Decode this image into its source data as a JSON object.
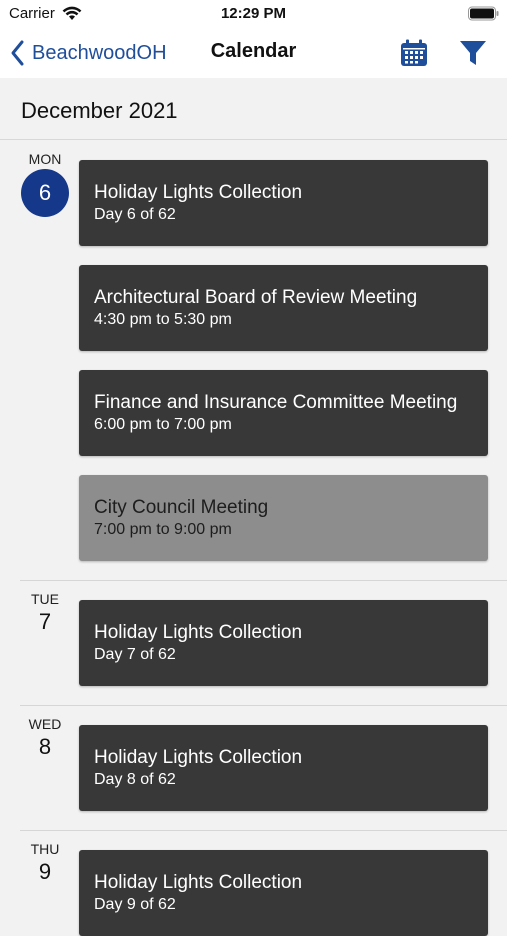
{
  "status": {
    "carrier": "Carrier",
    "time": "12:29 PM"
  },
  "nav": {
    "back_label": "BeachwoodOH",
    "title": "Calendar",
    "calendar_icon": "calendar-icon",
    "filter_icon": "filter-icon",
    "accent": "#1f4e9a"
  },
  "month": "December 2021",
  "days": [
    {
      "weekday": "MON",
      "day": "6",
      "selected": true,
      "events": [
        {
          "title": "Holiday Lights Collection",
          "sub": "Day 6 of 62",
          "muted": false
        },
        {
          "title": "Architectural Board of Review Meeting",
          "sub": "4:30 pm to 5:30 pm",
          "muted": false
        },
        {
          "title": "Finance and Insurance Committee Meeting",
          "sub": "6:00 pm to 7:00 pm",
          "muted": false
        },
        {
          "title": "City Council Meeting",
          "sub": "7:00 pm to 9:00 pm",
          "muted": true
        }
      ]
    },
    {
      "weekday": "TUE",
      "day": "7",
      "selected": false,
      "events": [
        {
          "title": "Holiday Lights Collection",
          "sub": "Day 7 of 62",
          "muted": false
        }
      ]
    },
    {
      "weekday": "WED",
      "day": "8",
      "selected": false,
      "events": [
        {
          "title": "Holiday Lights Collection",
          "sub": "Day 8 of 62",
          "muted": false
        }
      ]
    },
    {
      "weekday": "THU",
      "day": "9",
      "selected": false,
      "events": [
        {
          "title": "Holiday Lights Collection",
          "sub": "Day 9 of 62",
          "muted": false
        }
      ]
    }
  ],
  "colors": {
    "card": "#383838",
    "card_muted": "#8d8d8d",
    "selected_day": "#16388a"
  }
}
